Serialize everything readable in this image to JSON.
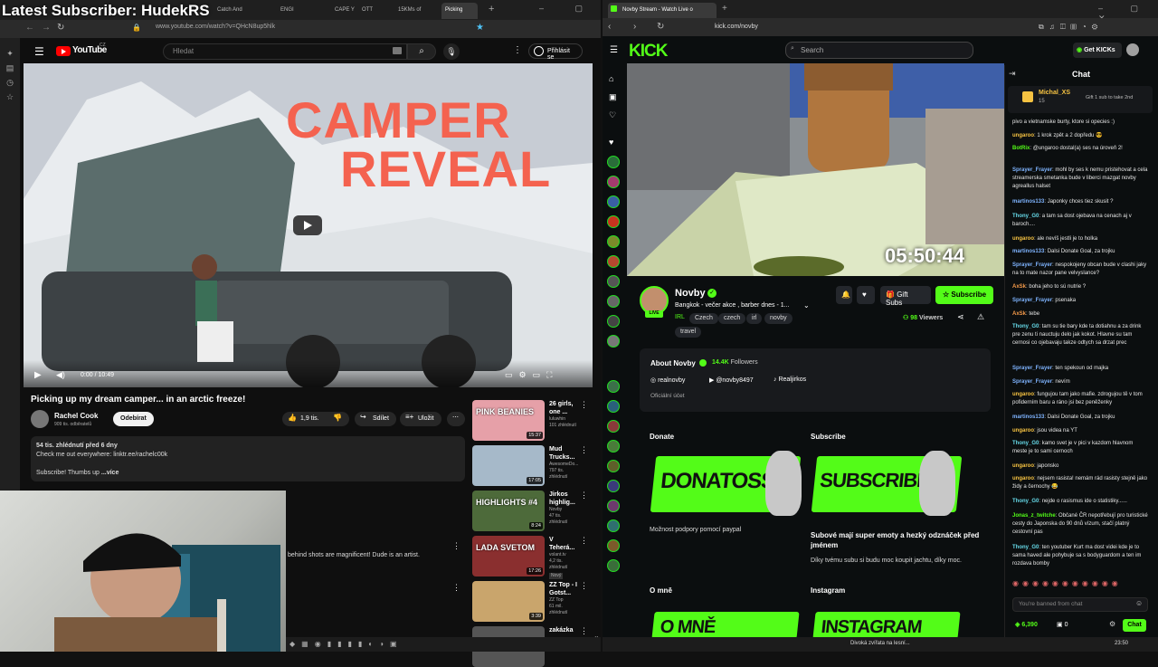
{
  "overlay": {
    "text": "Latest Subscriber: HudekRS"
  },
  "left_browser": {
    "tabs": [
      "Catch And",
      "ENGI",
      "CAPE YO",
      "OTT",
      "15KMs of",
      "Picking"
    ],
    "url": "www.youtube.com/watch?v=QHcN8up5hlk",
    "youtube": {
      "logo": "YouTube",
      "region": "CZ",
      "search_placeholder": "Hledat",
      "signin": "Přihlásit se",
      "video_overlay_line1": "CAMPER",
      "video_overlay_line2": "REVEAL",
      "time": "0:00 / 10:49",
      "title": "Picking up my dream camper... in an arctic freeze!",
      "channel": "Rachel Cook",
      "subscribers": "909 tis. odběratelů",
      "subscribe": "Odebírat",
      "likes": "1,9 tis.",
      "share": "Sdílet",
      "save": "Uložit",
      "desc_line1": "54 tis. zhlédnutí  před 6 dny",
      "desc_line2": "Check me out everywhere: linktr.ee/rachelc00k",
      "desc_line3": "Subscribe! Thumbs up",
      "desc_more": "...více",
      "comment_fragment": "behind shots are magnificent! Dude is an artist.",
      "recs": [
        {
          "title": "26 girls, one ...",
          "channel": "luluwhin",
          "views": "101 zhlédnutí",
          "duration": "15:37",
          "thumb_text": "PINK BEANIES",
          "color": "#e6a0a8"
        },
        {
          "title": "Mud Trucks...",
          "channel": "AwesomeDo...",
          "views": "797 tis. zhlédnutí",
          "duration": "17:05",
          "thumb_text": "",
          "color": "#a6b9c9"
        },
        {
          "title": "Jirkos highlig...",
          "channel": "Novby",
          "views": "47 tis. zhlédnutí",
          "duration": "8:24",
          "thumb_text": "HIGHLIGHTS #4",
          "color": "#4d6a3a"
        },
        {
          "title": "V Teherá...",
          "channel": "volant.tv",
          "views": "4,2 tis. zhlédnutí",
          "duration": "17:26",
          "thumb_text": "LADA SVETOM",
          "color": "#8a2f2f",
          "badge": "Nový"
        },
        {
          "title": "ZZ Top - I Gotst...",
          "channel": "ZZ Top",
          "views": "61 mil. zhlédnutí",
          "duration": "3:39",
          "thumb_text": "",
          "color": "#c9a56c"
        },
        {
          "title": "zakázka",
          "channel": "",
          "views": "",
          "duration": "",
          "thumb_text": "",
          "color": "#555"
        }
      ]
    }
  },
  "right_browser": {
    "tab_title": "Novby Stream - Watch Live o",
    "url": "kick.com/novby",
    "kick": {
      "search_placeholder": "Search",
      "get_kicks": "Get KICKs",
      "timer": "05:50:44",
      "streamer": "Novby",
      "live": "LIVE",
      "stream_title": "Bangkok - večer akce , barber dnes - 1...",
      "category": "IRL",
      "tags": [
        "Czech",
        "czech",
        "irl",
        "novby",
        "travel"
      ],
      "gift_subs": "Gift Subs",
      "subscribe": "Subscribe",
      "viewers": "98",
      "viewers_label": "Viewers",
      "about_title": "About Novby",
      "followers": "14.4K",
      "followers_label": "Followers",
      "socials": [
        "realnovby",
        "@novby8497",
        "Realjirkos"
      ],
      "official_account": "Oficiální účet",
      "donate_header": "Donate",
      "donate_img_text": "DONATOSS",
      "donate_desc": "Možnost podpory pomocí paypal",
      "subscribe_header": "Subscribe",
      "subscribe_img_text": "SUBSCRIBE",
      "subscribe_desc_bold": "Subové mají super emoty a hezký odznáček před jménem",
      "subscribe_desc": "Díky tvému subu si budu moc koupit jachtu, díky moc.",
      "omne_header": "O mně",
      "omne_img_text": "O MNĚ",
      "instagram_header": "Instagram",
      "instagram_img_text": "INSTAGRAM"
    },
    "chat": {
      "title": "Chat",
      "pinned_user": "Michal_XS",
      "pinned_count": "15",
      "pinned_text": "Gift 1 sub to take 2nd",
      "messages": [
        {
          "user": "",
          "text": "pivo a vietnamske burty, ktore si opecies :)",
          "color": "#fff"
        },
        {
          "user": "ungaroo",
          "text": "1 krok zpět a 2 dopředu 😎",
          "color": "#f5c242"
        },
        {
          "user": "BotRix",
          "text": "@ungaroo dostal(a) ses na úroveň 2!",
          "color": "#53fc18"
        },
        {
          "user": "Sprayer_Frayer",
          "text": "mohl by ses k nemu pristehovat a cela streamerska smetanka bude v liberci mazgat novby agreallus halset",
          "color": "#7fb4ff"
        },
        {
          "user": "martinos133",
          "text": "Japonky chces tiez skusit ?",
          "color": "#7fb4ff"
        },
        {
          "user": "Thony_G0",
          "text": "a tam sa dost ojebava na cenach aj v baroch....",
          "color": "#66d9e8"
        },
        {
          "user": "ungaroo",
          "text": "ale nevíš jestli je to holka",
          "color": "#f5c242"
        },
        {
          "user": "martinos133",
          "text": "Dalsi Donate Goal, za trojku",
          "color": "#7fb4ff"
        },
        {
          "user": "Sprayer_Frayer",
          "text": "nespokojeny obcan bude v clashi jaky na to mate nazor pane velvyslance?",
          "color": "#7fb4ff"
        },
        {
          "user": "AxSk",
          "text": "boha jeho to sú nutrie ?",
          "color": "#f59a4a"
        },
        {
          "user": "Sprayer_Frayer",
          "text": "psenaka",
          "color": "#7fb4ff"
        },
        {
          "user": "AxSk",
          "text": "tebe",
          "color": "#f59a4a"
        },
        {
          "user": "Thony_G0",
          "text": "tam su tie bary kde ta dotiahnu a za drink pre zenu ti nauctuju delo jak kokot. Hlavne su tam cernosi co ojebavaju takze odtych sa drzat prec",
          "color": "#66d9e8"
        },
        {
          "user": "Sprayer_Frayer",
          "text": "ten spekoun od majka",
          "color": "#7fb4ff"
        },
        {
          "user": "Sprayer_Frayer",
          "text": "nevím",
          "color": "#7fb4ff"
        },
        {
          "user": "ungaroo",
          "text": "fungujou tam jako mafie. zdrogujou tě v tom pofiderním baru a ráno jsi bez peněženky",
          "color": "#f5c242"
        },
        {
          "user": "martinos133",
          "text": "Dalsi Donate Goal, za trojku",
          "color": "#7fb4ff"
        },
        {
          "user": "ungaroo",
          "text": "jsou videa na YT",
          "color": "#f5c242"
        },
        {
          "user": "Thony_G0",
          "text": "kamo svet je v pici v kazdom hlavnom meste je to sami cernoch",
          "color": "#66d9e8"
        },
        {
          "user": "ungaroo",
          "text": "japonsko",
          "color": "#f5c242"
        },
        {
          "user": "ungaroo",
          "text": "nejsem rasista! nemám rád rasisty stejně jako židy a černochy 😂",
          "color": "#f5c242"
        },
        {
          "user": "Thony_G0",
          "text": "nejde o rasismus ide o statistiky......",
          "color": "#66d9e8"
        },
        {
          "user": "Jonas_z_twitche",
          "text": "Občané ČR nepotřebují pro turistické cesty do Japonska do 90 dnů vízum, stačí platný cestovní pas",
          "color": "#53fc18"
        },
        {
          "user": "Thony_G0",
          "text": "ten youtuber Kurt ma dost videi kde je to sama haved ale pohybuje sa s bodyguardom a ten im rozdava bomby",
          "color": "#66d9e8"
        }
      ],
      "input_placeholder": "You're banned from chat",
      "points": "6,390",
      "zero": "0",
      "send": "Chat"
    }
  },
  "taskbar": {
    "now_playing": "Divoká zvířata na lesní...",
    "time": "23:50"
  }
}
